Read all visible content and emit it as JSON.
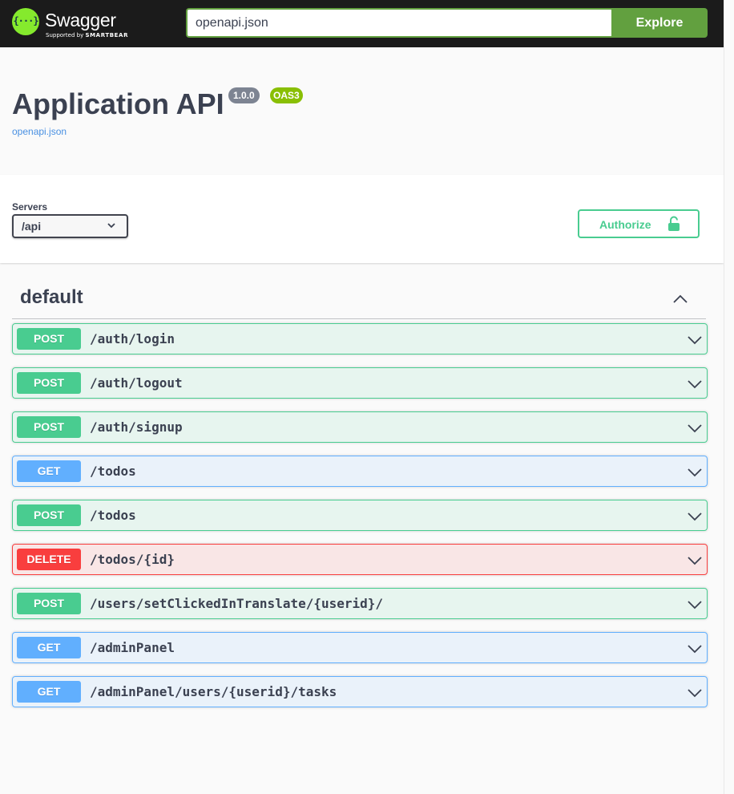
{
  "topbar": {
    "logo_name": "Swagger",
    "logo_sub_prefix": "Supported by",
    "logo_sub_brand": "SMARTBEAR",
    "logo_glyph": "{···}",
    "url_value": "openapi.json",
    "explore_label": "Explore"
  },
  "info": {
    "title": "Application API",
    "version": "1.0.0",
    "oas": "OAS3",
    "spec_link": "openapi.json"
  },
  "servers": {
    "label": "Servers",
    "selected": "/api",
    "authorize_label": "Authorize"
  },
  "tag": {
    "name": "default"
  },
  "operations": [
    {
      "method": "POST",
      "path": "/auth/login"
    },
    {
      "method": "POST",
      "path": "/auth/logout"
    },
    {
      "method": "POST",
      "path": "/auth/signup"
    },
    {
      "method": "GET",
      "path": "/todos"
    },
    {
      "method": "POST",
      "path": "/todos"
    },
    {
      "method": "DELETE",
      "path": "/todos/{id}"
    },
    {
      "method": "POST",
      "path": "/users/setClickedInTranslate/{userid}/"
    },
    {
      "method": "GET",
      "path": "/adminPanel"
    },
    {
      "method": "GET",
      "path": "/adminPanel/users/{userid}/tasks"
    }
  ],
  "colors": {
    "post": "#49cc90",
    "get": "#61affe",
    "delete": "#f93e3e",
    "topbar": "#1b1b1b",
    "explore": "#62a03f"
  }
}
